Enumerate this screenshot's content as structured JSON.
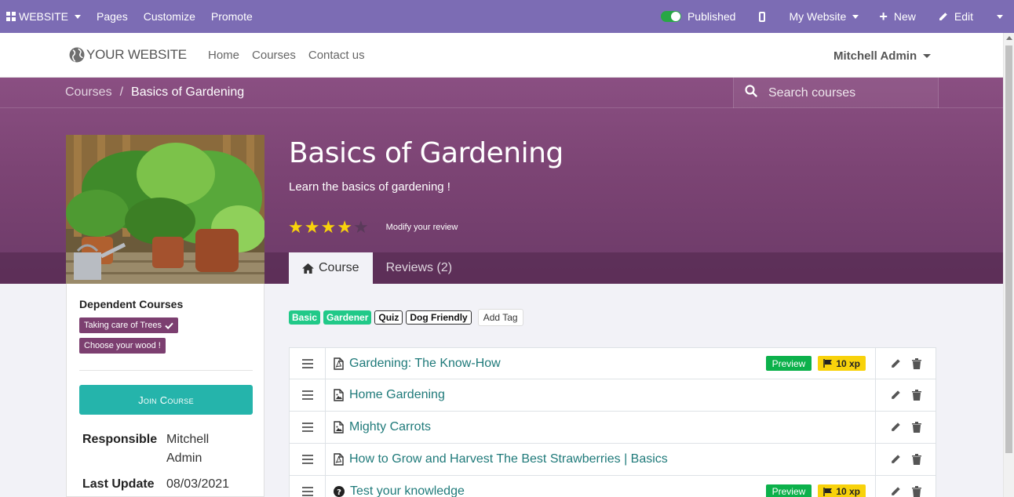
{
  "editor_bar": {
    "website_label": "WEBSITE",
    "pages_label": "Pages",
    "customize_label": "Customize",
    "promote_label": "Promote",
    "published_label": "Published",
    "my_website_label": "My Website",
    "new_label": "New",
    "edit_label": "Edit",
    "bar_color": "#7c6cb4"
  },
  "site_nav": {
    "logo_text": "YOUR WEBSITE",
    "links": [
      "Home",
      "Courses",
      "Contact us"
    ],
    "user_name": "Mitchell Admin"
  },
  "breadcrumb": {
    "parent": "Courses",
    "separator": "/",
    "current": "Basics of Gardening"
  },
  "search": {
    "placeholder": "Search courses"
  },
  "course": {
    "title": "Basics of Gardening",
    "subtitle": "Learn the basics of gardening !",
    "rating": 4,
    "rating_max": 5,
    "modify_review_label": "Modify your review"
  },
  "tabs": [
    {
      "label": "Course",
      "icon": "home-icon",
      "active": true
    },
    {
      "label": "Reviews (2)",
      "active": false
    }
  ],
  "sidebar": {
    "dependent_title": "Dependent Courses",
    "dependent_courses": [
      "Taking care of Trees",
      "Choose your wood !"
    ],
    "join_label": "Join Course",
    "responsible_label": "Responsible",
    "responsible_value_1": "Mitchell",
    "responsible_value_2": "Admin",
    "last_update_label": "Last Update",
    "last_update_value": "08/03/2021"
  },
  "tags": {
    "items": [
      "Basic",
      "Gardener",
      "Quiz",
      "Dog Friendly"
    ],
    "add_label": "Add Tag"
  },
  "content_rows": [
    {
      "title": "Gardening: The Know-How",
      "icon": "pdf-icon",
      "preview": "Preview",
      "xp": "10 xp"
    },
    {
      "title": "Home Gardening",
      "icon": "image-icon"
    },
    {
      "title": "Mighty Carrots",
      "icon": "image-icon"
    },
    {
      "title": "How to Grow and Harvest The Best Strawberries | Basics",
      "icon": "pdf-icon"
    },
    {
      "title": "Test your knowledge",
      "icon": "question-icon",
      "preview": "Preview",
      "xp": "10 xp"
    }
  ],
  "colors": {
    "hero": "#7c4474",
    "join_button": "#25b4ab",
    "link": "#1f7a7a",
    "preview_badge": "#0cb14b",
    "xp_badge": "#f8d20b",
    "dependent_badge": "#7c3f70"
  }
}
